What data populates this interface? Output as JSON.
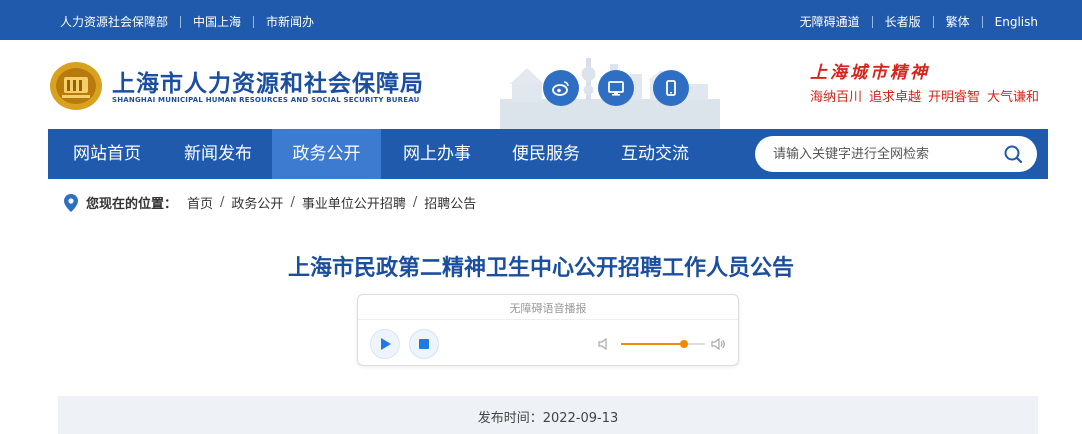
{
  "topbar": {
    "left_links": [
      "人力资源社会保障部",
      "中国上海",
      "市新闻办"
    ],
    "right_links": [
      "无障碍通道",
      "长者版",
      "繁体",
      "English"
    ]
  },
  "header": {
    "title": "上海市人力资源和社会保障局",
    "subtitle": "SHANGHAI MUNICIPAL HUMAN RESOURCES AND SOCIAL SECURITY BUREAU",
    "social_icons": [
      "weibo-icon",
      "desktop-icon",
      "mobile-icon"
    ],
    "spirit_title": "上海城市精神",
    "spirit_slogans": [
      "海纳百川",
      "追求卓越",
      "开明睿智",
      "大气谦和"
    ]
  },
  "nav": {
    "items": [
      "网站首页",
      "新闻发布",
      "政务公开",
      "网上办事",
      "便民服务",
      "互动交流"
    ],
    "active_index": 2,
    "search_placeholder": "请输入关键字进行全网检索"
  },
  "breadcrumb": {
    "label": "您现在的位置：",
    "items": [
      "首页",
      "政务公开",
      "事业单位公开招聘",
      "招聘公告"
    ]
  },
  "article": {
    "title": "上海市民政第二精神卫生中心公开招聘工作人员公告",
    "player_title": "无障碍语音播报",
    "volume_level": 0.75,
    "published": "发布时间：2022-09-13"
  },
  "colors": {
    "primary": "#1f5aad",
    "active_nav": "#3c7bd0",
    "title_blue": "#1b4e9e",
    "slogan_red": "#d4261c",
    "volume_orange": "#f08a00"
  }
}
